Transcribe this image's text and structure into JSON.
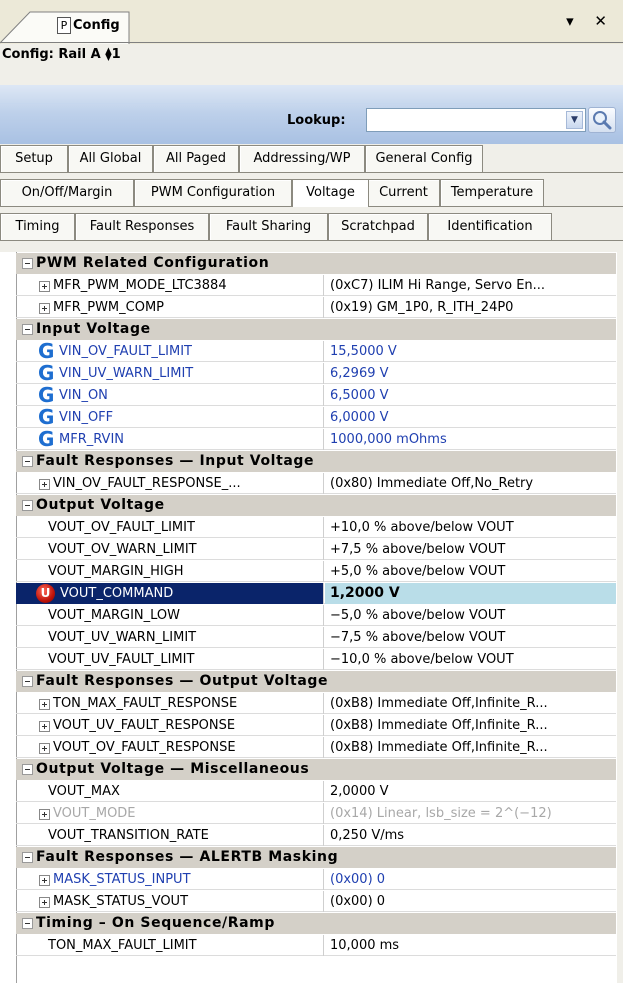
{
  "window": {
    "tab_badge": "P",
    "tab_title": "Config",
    "controls": "▾ ✕",
    "config_title": "Config: Rail A ⧫1"
  },
  "lookup": {
    "label": "Lookup:",
    "value": "",
    "dropdown_icon": "chevron-down-icon",
    "search_icon": "magnifier-icon"
  },
  "tabs": {
    "row1": [
      "Setup",
      "All Global",
      "All Paged",
      "Addressing/WP",
      "General Config"
    ],
    "row2": [
      "On/Off/Margin",
      "PWM Configuration",
      "Voltage",
      "Current",
      "Temperature"
    ],
    "row3": [
      "Timing",
      "Fault Responses",
      "Fault Sharing",
      "Scratchpad",
      "Identification"
    ],
    "active": "Voltage"
  },
  "grid": [
    {
      "kind": "cat",
      "label": "PWM Related Configuration"
    },
    {
      "kind": "row",
      "plus": true,
      "name": "MFR_PWM_MODE_LTC3884",
      "value": "(0xC7) ILIM Hi Range, Servo En..."
    },
    {
      "kind": "row",
      "plus": true,
      "name": "MFR_PWM_COMP",
      "value": "(0x19) GM_1P0, R_ITH_24P0"
    },
    {
      "kind": "cat",
      "label": "Input Voltage"
    },
    {
      "kind": "row",
      "g": true,
      "blue": true,
      "name": "VIN_OV_FAULT_LIMIT",
      "value": "15,5000 V"
    },
    {
      "kind": "row",
      "g": true,
      "blue": true,
      "name": "VIN_UV_WARN_LIMIT",
      "value": "6,2969 V"
    },
    {
      "kind": "row",
      "g": true,
      "blue": true,
      "name": "VIN_ON",
      "value": "6,5000 V"
    },
    {
      "kind": "row",
      "g": true,
      "blue": true,
      "name": "VIN_OFF",
      "value": "6,0000 V"
    },
    {
      "kind": "row",
      "g": true,
      "blue": true,
      "name": "MFR_RVIN",
      "value": "1000,000 mOhms"
    },
    {
      "kind": "cat",
      "label": "Fault Responses — Input Voltage"
    },
    {
      "kind": "row",
      "plus": true,
      "name": "VIN_OV_FAULT_RESPONSE_...",
      "value": "(0x80) Immediate Off,No_Retry"
    },
    {
      "kind": "cat",
      "label": "Output Voltage"
    },
    {
      "kind": "row",
      "name": "VOUT_OV_FAULT_LIMIT",
      "value": "+10,0 % above/below VOUT"
    },
    {
      "kind": "row",
      "name": "VOUT_OV_WARN_LIMIT",
      "value": "+7,5 % above/below VOUT"
    },
    {
      "kind": "row",
      "name": "VOUT_MARGIN_HIGH",
      "value": "+5,0 % above/below VOUT"
    },
    {
      "kind": "row",
      "selected": true,
      "name": "VOUT_COMMAND",
      "value": "1,2000 V"
    },
    {
      "kind": "row",
      "name": "VOUT_MARGIN_LOW",
      "value": "−5,0 % above/below VOUT"
    },
    {
      "kind": "row",
      "name": "VOUT_UV_WARN_LIMIT",
      "value": "−7,5 % above/below VOUT"
    },
    {
      "kind": "row",
      "name": "VOUT_UV_FAULT_LIMIT",
      "value": "−10,0 % above/below VOUT"
    },
    {
      "kind": "cat",
      "label": "Fault Responses — Output Voltage"
    },
    {
      "kind": "row",
      "plus": true,
      "name": "TON_MAX_FAULT_RESPONSE",
      "value": "(0xB8) Immediate Off,Infinite_R..."
    },
    {
      "kind": "row",
      "plus": true,
      "name": "VOUT_UV_FAULT_RESPONSE",
      "value": "(0xB8) Immediate Off,Infinite_R..."
    },
    {
      "kind": "row",
      "plus": true,
      "name": "VOUT_OV_FAULT_RESPONSE",
      "value": "(0xB8) Immediate Off,Infinite_R..."
    },
    {
      "kind": "cat",
      "label": "Output Voltage — Miscellaneous"
    },
    {
      "kind": "row",
      "name": "VOUT_MAX",
      "value": "2,0000 V"
    },
    {
      "kind": "row",
      "plus": true,
      "gray": true,
      "name": "VOUT_MODE",
      "value": "(0x14) Linear, lsb_size = 2^(−12)"
    },
    {
      "kind": "row",
      "name": "VOUT_TRANSITION_RATE",
      "value": "0,250 V/ms"
    },
    {
      "kind": "cat",
      "label": "Fault Responses — ALERTB Masking"
    },
    {
      "kind": "row",
      "plus": true,
      "blue": true,
      "name": "MASK_STATUS_INPUT",
      "value": "(0x00) 0"
    },
    {
      "kind": "row",
      "plus": true,
      "name": "MASK_STATUS_VOUT",
      "value": "(0x00) 0"
    },
    {
      "kind": "cat",
      "label": "Timing – On Sequence/Ramp"
    },
    {
      "kind": "row",
      "name": "TON_MAX_FAULT_LIMIT",
      "value": "10,000 ms"
    }
  ]
}
